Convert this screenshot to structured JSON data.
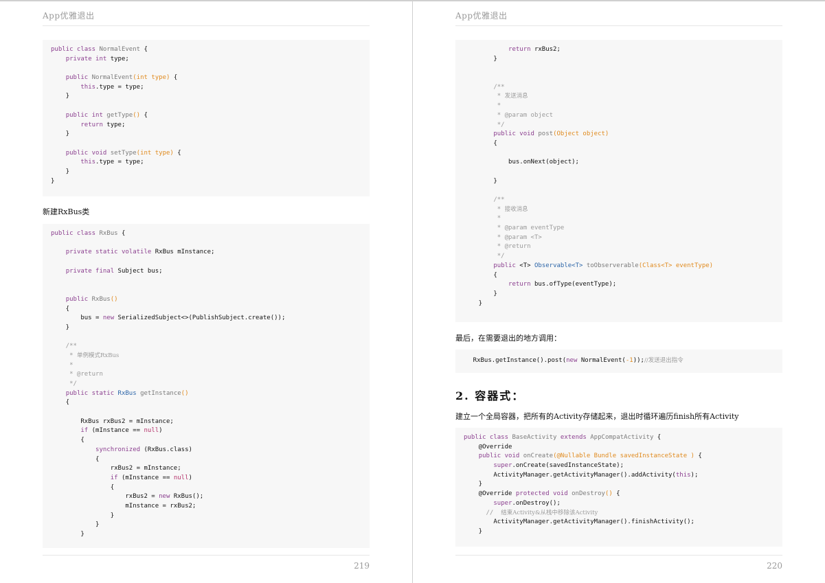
{
  "pages": [
    {
      "running_title": "App优雅退出",
      "page_number": "219",
      "blocks": [
        {
          "kind": "code",
          "lines": [
            [
              [
                "kw",
                "public class "
              ],
              [
                "cls",
                "NormalEvent"
              ],
              [
                "p",
                " {"
              ]
            ],
            [
              [
                "p",
                "    "
              ],
              [
                "kw",
                "private int "
              ],
              [
                "p",
                "type;"
              ]
            ],
            [],
            [
              [
                "p",
                "    "
              ],
              [
                "kw",
                "public "
              ],
              [
                "cls",
                "NormalEvent"
              ],
              [
                "par",
                "(int type)"
              ],
              [
                "p",
                " {"
              ]
            ],
            [
              [
                "p",
                "        "
              ],
              [
                "kw",
                "this"
              ],
              [
                "p",
                ".type = type;"
              ]
            ],
            [
              [
                "p",
                "    }"
              ]
            ],
            [],
            [
              [
                "p",
                "    "
              ],
              [
                "kw",
                "public int "
              ],
              [
                "cls",
                "getType"
              ],
              [
                "par",
                "()"
              ],
              [
                "p",
                " {"
              ]
            ],
            [
              [
                "p",
                "        "
              ],
              [
                "kw",
                "return "
              ],
              [
                "p",
                "type;"
              ]
            ],
            [
              [
                "p",
                "    }"
              ]
            ],
            [],
            [
              [
                "p",
                "    "
              ],
              [
                "kw",
                "public void "
              ],
              [
                "cls",
                "setType"
              ],
              [
                "par",
                "(int type)"
              ],
              [
                "p",
                " {"
              ]
            ],
            [
              [
                "p",
                "        "
              ],
              [
                "kw",
                "this"
              ],
              [
                "p",
                ".type = type;"
              ]
            ],
            [
              [
                "p",
                "    }"
              ]
            ],
            [
              [
                "p",
                "}"
              ]
            ]
          ]
        },
        {
          "kind": "para",
          "text": "新建RxBus类"
        },
        {
          "kind": "code",
          "lines": [
            [
              [
                "kw",
                "public class "
              ],
              [
                "cls",
                "RxBus"
              ],
              [
                "p",
                " {"
              ]
            ],
            [],
            [
              [
                "p",
                "    "
              ],
              [
                "kw",
                "private static volatile "
              ],
              [
                "p",
                "RxBus mInstance;"
              ]
            ],
            [],
            [
              [
                "p",
                "    "
              ],
              [
                "kw",
                "private final "
              ],
              [
                "p",
                "Subject bus;"
              ]
            ],
            [],
            [],
            [
              [
                "p",
                "    "
              ],
              [
                "kw",
                "public "
              ],
              [
                "cls",
                "RxBus"
              ],
              [
                "par",
                "()"
              ]
            ],
            [
              [
                "p",
                "    {"
              ]
            ],
            [
              [
                "p",
                "        bus = "
              ],
              [
                "kw",
                "new "
              ],
              [
                "p",
                "SerializedSubject<>(PublishSubject.create());"
              ]
            ],
            [
              [
                "p",
                "    }"
              ]
            ],
            [],
            [
              [
                "cmm",
                "    /**"
              ]
            ],
            [
              [
                "cmm",
                "     * "
              ],
              [
                "cm",
                "单例模式RxBus"
              ]
            ],
            [
              [
                "cmm",
                "     *"
              ]
            ],
            [
              [
                "cmm",
                "     * @return"
              ]
            ],
            [
              [
                "cmm",
                "     */"
              ]
            ],
            [
              [
                "p",
                "    "
              ],
              [
                "kw",
                "public static "
              ],
              [
                "type",
                "RxBus "
              ],
              [
                "cls",
                "getInstance"
              ],
              [
                "par",
                "()"
              ]
            ],
            [
              [
                "p",
                "    {"
              ]
            ],
            [],
            [
              [
                "p",
                "        RxBus rxBus2 = mInstance;"
              ]
            ],
            [
              [
                "p",
                "        "
              ],
              [
                "kw",
                "if "
              ],
              [
                "p",
                "(mInstance == "
              ],
              [
                "lit",
                "null"
              ],
              [
                "p",
                ")"
              ]
            ],
            [
              [
                "p",
                "        {"
              ]
            ],
            [
              [
                "p",
                "            "
              ],
              [
                "kw",
                "synchronized "
              ],
              [
                "p",
                "(RxBus.class)"
              ]
            ],
            [
              [
                "p",
                "            {"
              ]
            ],
            [
              [
                "p",
                "                rxBus2 = mInstance;"
              ]
            ],
            [
              [
                "p",
                "                "
              ],
              [
                "kw",
                "if "
              ],
              [
                "p",
                "(mInstance == "
              ],
              [
                "lit",
                "null"
              ],
              [
                "p",
                ")"
              ]
            ],
            [
              [
                "p",
                "                {"
              ]
            ],
            [
              [
                "p",
                "                    rxBus2 = "
              ],
              [
                "kw",
                "new "
              ],
              [
                "p",
                "RxBus();"
              ]
            ],
            [
              [
                "p",
                "                    mInstance = rxBus2;"
              ]
            ],
            [
              [
                "p",
                "                }"
              ]
            ],
            [
              [
                "p",
                "            }"
              ]
            ],
            [
              [
                "p",
                "        }"
              ]
            ]
          ]
        }
      ]
    },
    {
      "running_title": "App优雅退出",
      "page_number": "220",
      "blocks": [
        {
          "kind": "code",
          "lines": [
            [
              [
                "p",
                "            "
              ],
              [
                "kw",
                "return "
              ],
              [
                "p",
                "rxBus2;"
              ]
            ],
            [
              [
                "p",
                "        }"
              ]
            ],
            [],
            [],
            [
              [
                "cmm",
                "        /**"
              ]
            ],
            [
              [
                "cmm",
                "         * "
              ],
              [
                "cm",
                "发送消息"
              ]
            ],
            [
              [
                "cmm",
                "         *"
              ]
            ],
            [
              [
                "cmm",
                "         * @param object"
              ]
            ],
            [
              [
                "cmm",
                "         */"
              ]
            ],
            [
              [
                "p",
                "        "
              ],
              [
                "kw",
                "public void "
              ],
              [
                "cls",
                "post"
              ],
              [
                "par",
                "(Object object)"
              ]
            ],
            [
              [
                "p",
                "        {"
              ]
            ],
            [],
            [
              [
                "p",
                "            bus.onNext(object);"
              ]
            ],
            [],
            [
              [
                "p",
                "        }"
              ]
            ],
            [],
            [
              [
                "cmm",
                "        /**"
              ]
            ],
            [
              [
                "cmm",
                "         * "
              ],
              [
                "cm",
                "接收消息"
              ]
            ],
            [
              [
                "cmm",
                "         *"
              ]
            ],
            [
              [
                "cmm",
                "         * @param eventType"
              ]
            ],
            [
              [
                "cmm",
                "         * @param <T>"
              ]
            ],
            [
              [
                "cmm",
                "         * @return"
              ]
            ],
            [
              [
                "cmm",
                "         */"
              ]
            ],
            [
              [
                "p",
                "        "
              ],
              [
                "kw",
                "public "
              ],
              [
                "p",
                "<T> "
              ],
              [
                "type",
                "Observable<T> "
              ],
              [
                "cls",
                "toObserverable"
              ],
              [
                "par",
                "(Class<T> eventType)"
              ]
            ],
            [
              [
                "p",
                "        {"
              ]
            ],
            [
              [
                "p",
                "            "
              ],
              [
                "kw",
                "return "
              ],
              [
                "p",
                "bus.ofType(eventType);"
              ]
            ],
            [
              [
                "p",
                "        }"
              ]
            ],
            [
              [
                "p",
                "    }"
              ]
            ]
          ]
        },
        {
          "kind": "para",
          "text": "最后，在需要退出的地方调用："
        },
        {
          "kind": "code",
          "lines": [
            [
              [
                "p",
                "    RxBus.getInstance().post("
              ],
              [
                "kw",
                "new "
              ],
              [
                "p",
                "NormalEvent("
              ],
              [
                "num",
                "-1"
              ],
              [
                "p",
                "));"
              ],
              [
                "cm",
                "//发送退出指令"
              ]
            ]
          ]
        },
        {
          "kind": "heading",
          "number": "2.",
          "text": "容器式："
        },
        {
          "kind": "para",
          "text": "建立一个全局容器，把所有的Activity存储起来，退出时循环遍历finish所有Activity"
        },
        {
          "kind": "code",
          "lines": [
            [
              [
                "kw",
                "public class "
              ],
              [
                "cls",
                "BaseActivity "
              ],
              [
                "kw",
                "extends "
              ],
              [
                "cls",
                "AppCompatActivity"
              ],
              [
                "p",
                " {"
              ]
            ],
            [
              [
                "p",
                "    @Override"
              ]
            ],
            [
              [
                "p",
                "    "
              ],
              [
                "kw",
                "public void "
              ],
              [
                "cls",
                "onCreate"
              ],
              [
                "par",
                "(@Nullable Bundle savedInstanceState )"
              ],
              [
                "p",
                " {"
              ]
            ],
            [
              [
                "p",
                "        "
              ],
              [
                "kw",
                "super"
              ],
              [
                "p",
                ".onCreate(savedInstanceState);"
              ]
            ],
            [
              [
                "p",
                "        ActivityManager.getActivityManager().addActivity("
              ],
              [
                "kw",
                "this"
              ],
              [
                "p",
                ");"
              ]
            ],
            [
              [
                "p",
                "    }"
              ]
            ],
            [
              [
                "p",
                "    @Override "
              ],
              [
                "kw",
                "protected void "
              ],
              [
                "cls",
                "onDestroy"
              ],
              [
                "par",
                "()"
              ],
              [
                "p",
                " {"
              ]
            ],
            [
              [
                "p",
                "        "
              ],
              [
                "kw",
                "super"
              ],
              [
                "p",
                ".onDestroy();"
              ]
            ],
            [
              [
                "cmm",
                "      //  "
              ],
              [
                "cm",
                "结束Activity&从栈中移除该Activity"
              ]
            ],
            [
              [
                "p",
                "        ActivityManager.getActivityManager().finishActivity();"
              ]
            ],
            [
              [
                "p",
                "    }"
              ]
            ]
          ]
        }
      ]
    }
  ]
}
